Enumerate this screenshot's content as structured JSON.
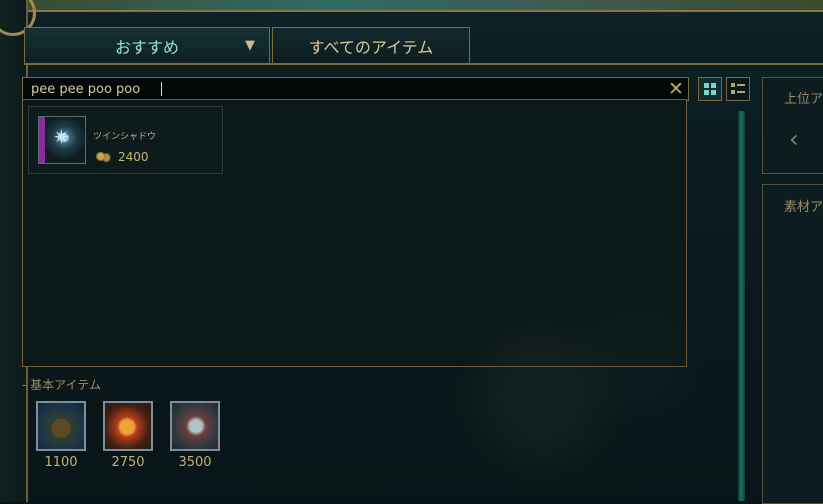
{
  "tabs": [
    {
      "label": "おすすめ",
      "dropdown_icon": "triangle-down-icon"
    },
    {
      "label": "すべてのアイテム"
    }
  ],
  "search": {
    "value": "pee pee poo poo",
    "placeholder": ""
  },
  "results": [
    {
      "name": "ツインシャドウ",
      "cost": "2400",
      "icon": "twin-shadows-icon"
    }
  ],
  "side_panel": {
    "top_label": "上位ア",
    "bottom_label": "素材ア"
  },
  "basic_items": {
    "heading": "- 基本アイテム",
    "items": [
      {
        "price": "1100",
        "icon": "boots-item-icon"
      },
      {
        "price": "2750",
        "icon": "fire-item-icon"
      },
      {
        "price": "3500",
        "icon": "armor-item-icon"
      }
    ]
  },
  "colors": {
    "accent": "#8fe7d1",
    "gold": "#c8b06d",
    "border": "#7d6a40",
    "background": "#071417"
  }
}
